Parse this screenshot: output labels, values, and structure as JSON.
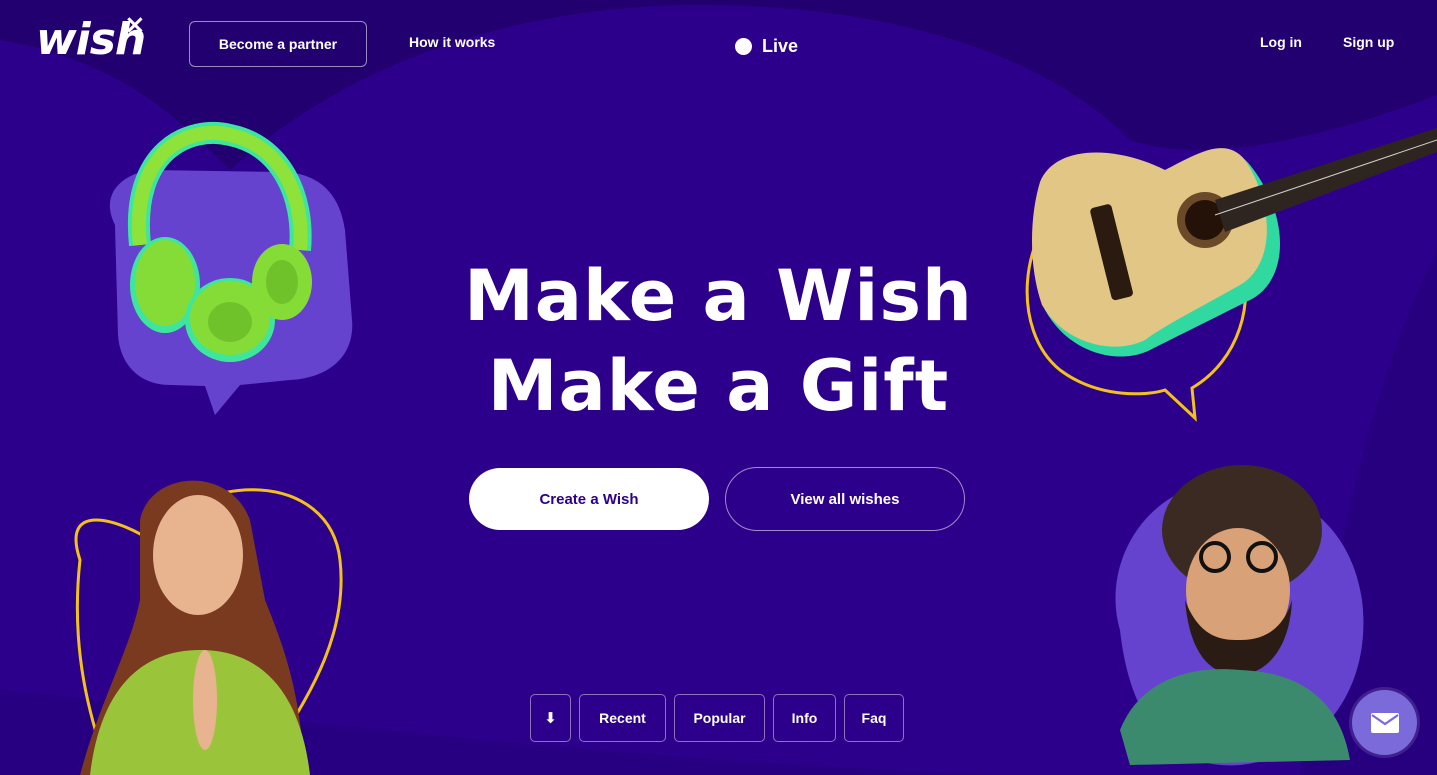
{
  "brand": {
    "logo_text": "wish",
    "logo_mark": "×"
  },
  "nav": {
    "partner_label": "Become a partner",
    "how_label": "How it works",
    "live_label": "Live",
    "login_label": "Log in",
    "signup_label": "Sign up"
  },
  "hero": {
    "line1": "Make a Wish",
    "line2": "Make a Gift",
    "cta_primary": "Create a Wish",
    "cta_secondary": "View all wishes"
  },
  "tabs": {
    "download_glyph": "⬇",
    "recent": "Recent",
    "popular": "Popular",
    "info": "Info",
    "faq": "Faq"
  },
  "colors": {
    "background": "#2d008c",
    "background_dark": "#220070",
    "accent_purple": "#6543cf",
    "accent_yellow": "#f2c21b",
    "accent_green": "#7fe335"
  },
  "icons": [
    "download-icon",
    "mail-icon",
    "headphones-illustration",
    "guitar-illustration"
  ]
}
